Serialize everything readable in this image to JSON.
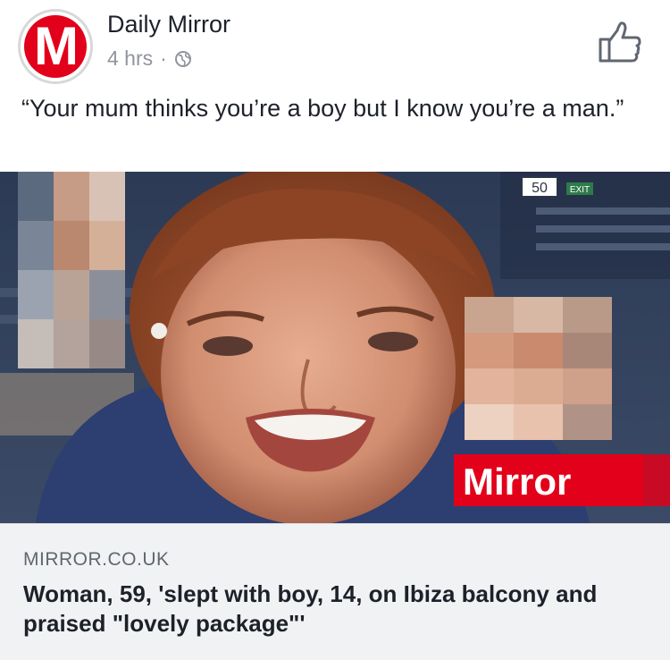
{
  "post": {
    "page_name": "Daily Mirror",
    "avatar_letter": "M",
    "time": "4 hrs",
    "separator": "·",
    "privacy_icon": "globe-icon",
    "like_icon": "thumbs-up-icon",
    "caption": "“Your mum thinks you’re a boy but I know you’re a man.”"
  },
  "image": {
    "watermark": "Mirror",
    "sign_number": "50",
    "sign_exit": "EXIT"
  },
  "link": {
    "domain": "MIRROR.CO.UK",
    "headline": "Woman, 59, 'slept with boy, 14, on Ibiza balcony and praised \"lovely package\"'"
  },
  "colors": {
    "brand_red": "#e2001a",
    "meta_gray": "#90949c",
    "link_bg": "#f1f2f4"
  }
}
